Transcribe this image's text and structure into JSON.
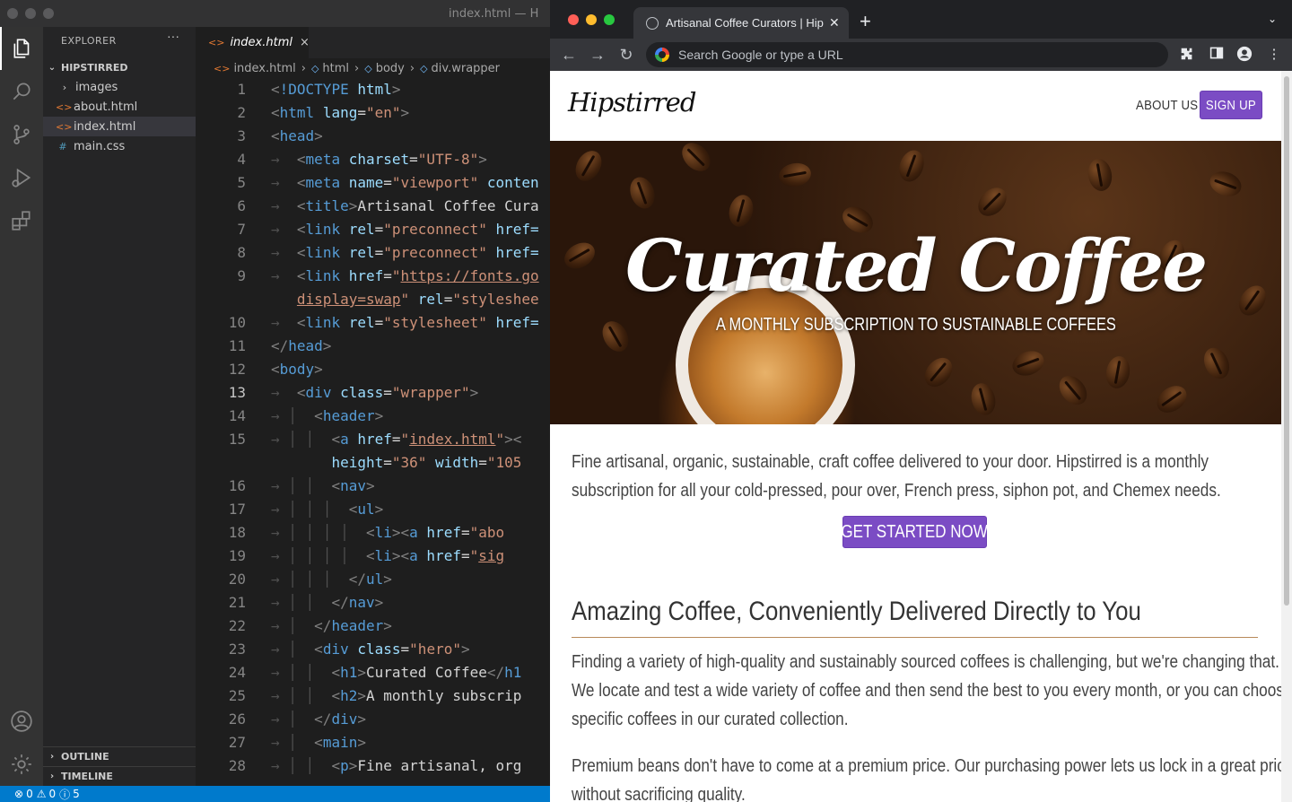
{
  "vscode": {
    "window_title": "index.html — H",
    "explorer": {
      "title": "EXPLORER",
      "more": "···",
      "folder": "HIPSTIRRED",
      "items": [
        {
          "label": "images",
          "type": "folder",
          "glyph": "›"
        },
        {
          "label": "about.html",
          "type": "html",
          "glyph": "<>"
        },
        {
          "label": "index.html",
          "type": "html",
          "glyph": "<>"
        },
        {
          "label": "main.css",
          "type": "css",
          "glyph": "#"
        }
      ],
      "outline": "OUTLINE",
      "timeline": "TIMELINE"
    },
    "tab": {
      "label": "index.html",
      "glyph": "<>",
      "close": "×"
    },
    "breadcrumb": [
      "index.html",
      "html",
      "body",
      "div.wrapper"
    ],
    "status": {
      "errors": "0",
      "warnings": "0",
      "info": "5"
    },
    "accent": "#007acc"
  },
  "browser": {
    "tab_title": "Artisanal Coffee Curators | Hipstirred",
    "new_tab": "+",
    "omnibox_placeholder": "Search Google or type a URL",
    "nav": {
      "back": "←",
      "forward": "→",
      "reload": "↻"
    },
    "site": {
      "logo": "Hipstirred",
      "nav_about": "ABOUT US",
      "nav_signup": "SIGN UP",
      "hero_title": "Curated Coffee",
      "hero_subtitle": "A MONTHLY SUBSCRIPTION TO SUSTAINABLE COFFEES",
      "intro_line1": "Fine artisanal, organic, sustainable, craft coffee delivered to your door. Hipstirred is a monthly",
      "intro_line2": "subscription for all your cold-pressed, pour over, French press, siphon pot, and Chemex needs.",
      "cta": "GET STARTED NOW",
      "section_title": "Amazing Coffee, Conveniently Delivered Directly to You",
      "p1_line1": "Finding a variety of high-quality and sustainably sourced coffees is challenging, but we're changing that.",
      "p1_line2": "We locate and test a wide variety of coffee and then send the best to you every month, or you can choose",
      "p1_line3": "specific coffees in our curated collection.",
      "p2_line1": "Premium beans don't have to come at a premium price. Our purchasing power lets us lock in a great price",
      "p2_line2": "without sacrificing quality.",
      "brand_color": "#7b4cc4"
    }
  },
  "code": [
    {
      "n": "1",
      "html": "<span class='p'>&lt;</span><span class='t'>!DOCTYPE</span> <span class='a'>html</span><span class='p'>&gt;</span>"
    },
    {
      "n": "2",
      "html": "<span class='p'>&lt;</span><span class='t'>html</span> <span class='a'>lang</span>=<span class='s'>\"en\"</span><span class='p'>&gt;</span>"
    },
    {
      "n": "3",
      "html": "<span class='p'>&lt;</span><span class='t'>head</span><span class='p'>&gt;</span>"
    },
    {
      "n": "4",
      "html": "<span class='ws'>→ </span> <span class='p'>&lt;</span><span class='t'>meta</span> <span class='a'>charset</span>=<span class='s'>\"UTF-8\"</span><span class='p'>&gt;</span>"
    },
    {
      "n": "5",
      "html": "<span class='ws'>→ </span> <span class='p'>&lt;</span><span class='t'>meta</span> <span class='a'>name</span>=<span class='s'>\"viewport\"</span> <span class='a'>conten</span>"
    },
    {
      "n": "6",
      "html": "<span class='ws'>→ </span> <span class='p'>&lt;</span><span class='t'>title</span><span class='p'>&gt;</span>Artisanal Coffee Cura"
    },
    {
      "n": "7",
      "html": "<span class='ws'>→ </span> <span class='p'>&lt;</span><span class='t'>link</span> <span class='a'>rel</span>=<span class='s'>\"preconnect\"</span> <span class='a'>href=</span>"
    },
    {
      "n": "8",
      "html": "<span class='ws'>→ </span> <span class='p'>&lt;</span><span class='t'>link</span> <span class='a'>rel</span>=<span class='s'>\"preconnect\"</span> <span class='a'>href=</span>"
    },
    {
      "n": "9",
      "html": "<span class='ws'>→ </span> <span class='p'>&lt;</span><span class='t'>link</span> <span class='a'>href</span>=<span class='s'>\"</span><span class='u'>https://fonts.go</span>"
    },
    {
      "n": "",
      "html": "<span class='ws'>  </span> <span class='u'>display=swap</span><span class='s'>\"</span> <span class='a'>rel</span>=<span class='s'>\"styleshee</span>"
    },
    {
      "n": "10",
      "html": "<span class='ws'>→ </span> <span class='p'>&lt;</span><span class='t'>link</span> <span class='a'>rel</span>=<span class='s'>\"stylesheet\"</span> <span class='a'>href=</span>"
    },
    {
      "n": "11",
      "html": "<span class='p'>&lt;/</span><span class='t'>head</span><span class='p'>&gt;</span>"
    },
    {
      "n": "12",
      "html": "<span class='p'>&lt;</span><span class='t'>body</span><span class='p'>&gt;</span>"
    },
    {
      "n": "13",
      "html": "<span class='ws'>→ </span> <span class='p'>&lt;</span><span class='t'>div</span> <span class='a'>class</span>=<span class='s'>\"wrapper\"</span><span class='p'>&gt;</span>",
      "cur": true
    },
    {
      "n": "14",
      "html": "<span class='ws'>→ │ </span> <span class='p'>&lt;</span><span class='t'>header</span><span class='p'>&gt;</span>"
    },
    {
      "n": "15",
      "html": "<span class='ws'>→ │ │ </span> <span class='p'>&lt;</span><span class='t'>a</span> <span class='a'>href</span>=<span class='s'>\"</span><span class='u'>index.html</span><span class='s'>\"</span><span class='p'>&gt;&lt;</span>"
    },
    {
      "n": "",
      "html": "<span class='ws'>      </span> <span class='a'>height</span>=<span class='s'>\"36\"</span> <span class='a'>width</span>=<span class='s'>\"105</span>"
    },
    {
      "n": "16",
      "html": "<span class='ws'>→ │ │ </span> <span class='p'>&lt;</span><span class='t'>nav</span><span class='p'>&gt;</span>"
    },
    {
      "n": "17",
      "html": "<span class='ws'>→ │ │ │ </span> <span class='p'>&lt;</span><span class='t'>ul</span><span class='p'>&gt;</span>"
    },
    {
      "n": "18",
      "html": "<span class='ws'>→ │ │ │ │ </span> <span class='p'>&lt;</span><span class='t'>li</span><span class='p'>&gt;&lt;</span><span class='t'>a</span> <span class='a'>href</span>=<span class='s'>\"abo</span>"
    },
    {
      "n": "19",
      "html": "<span class='ws'>→ │ │ │ │ </span> <span class='p'>&lt;</span><span class='t'>li</span><span class='p'>&gt;&lt;</span><span class='t'>a</span> <span class='a'>href</span>=<span class='s'>\"</span><span class='u'>sig</span>"
    },
    {
      "n": "20",
      "html": "<span class='ws'>→ │ │ │ </span> <span class='p'>&lt;/</span><span class='t'>ul</span><span class='p'>&gt;</span>"
    },
    {
      "n": "21",
      "html": "<span class='ws'>→ │ │ </span> <span class='p'>&lt;/</span><span class='t'>nav</span><span class='p'>&gt;</span>"
    },
    {
      "n": "22",
      "html": "<span class='ws'>→ │ </span> <span class='p'>&lt;/</span><span class='t'>header</span><span class='p'>&gt;</span>"
    },
    {
      "n": "23",
      "html": "<span class='ws'>→ │ </span> <span class='p'>&lt;</span><span class='t'>div</span> <span class='a'>class</span>=<span class='s'>\"hero\"</span><span class='p'>&gt;</span>"
    },
    {
      "n": "24",
      "html": "<span class='ws'>→ │ │ </span> <span class='p'>&lt;</span><span class='t'>h1</span><span class='p'>&gt;</span>Curated Coffee<span class='p'>&lt;/</span><span class='t'>h1</span>"
    },
    {
      "n": "25",
      "html": "<span class='ws'>→ │ │ </span> <span class='p'>&lt;</span><span class='t'>h2</span><span class='p'>&gt;</span>A monthly subscrip"
    },
    {
      "n": "26",
      "html": "<span class='ws'>→ │ </span> <span class='p'>&lt;/</span><span class='t'>div</span><span class='p'>&gt;</span>"
    },
    {
      "n": "27",
      "html": "<span class='ws'>→ │ </span> <span class='p'>&lt;</span><span class='t'>main</span><span class='p'>&gt;</span>"
    },
    {
      "n": "28",
      "html": "<span class='ws'>→ │ │ </span> <span class='p'>&lt;</span><span class='t'>p</span><span class='p'>&gt;</span>Fine artisanal, org"
    }
  ]
}
